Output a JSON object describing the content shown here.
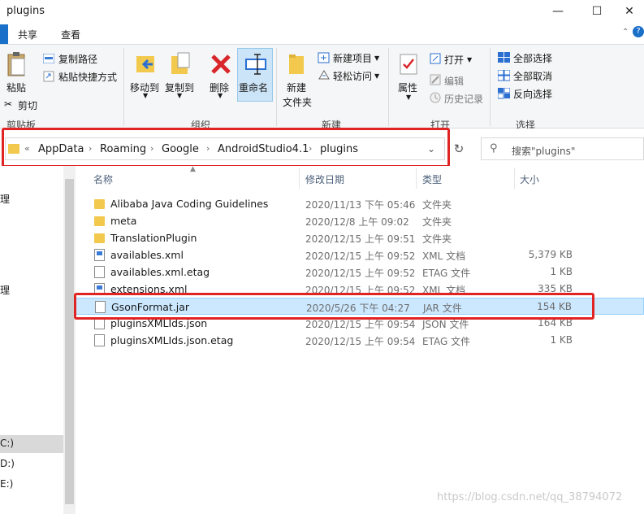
{
  "window": {
    "title": "plugins",
    "min": "—",
    "max": "☐",
    "close": "✕"
  },
  "tabs": {
    "share": "共享",
    "view": "查看",
    "help": "?"
  },
  "ribbon": {
    "clipboard": {
      "label": "剪贴板",
      "paste": "粘贴",
      "cut": "剪切",
      "copy_path": "复制路径",
      "paste_shortcut": "粘贴快捷方式"
    },
    "organize": {
      "label": "组织",
      "move_to": "移动到",
      "copy_to": "复制到",
      "delete": "删除",
      "rename": "重命名"
    },
    "new": {
      "label": "新建",
      "new_folder_1": "新建",
      "new_folder_2": "文件夹",
      "new_item": "新建项目",
      "easy_access": "轻松访问"
    },
    "open": {
      "label": "打开",
      "properties": "属性",
      "open": "打开",
      "edit": "编辑",
      "history": "历史记录"
    },
    "select": {
      "label": "选择",
      "select_all": "全部选择",
      "select_none": "全部取消",
      "invert": "反向选择"
    }
  },
  "address": {
    "overflow": "«",
    "crumbs": [
      "AppData",
      "Roaming",
      "Google",
      "AndroidStudio4.1",
      "plugins"
    ],
    "search_placeholder": "搜索\"plugins\""
  },
  "nav": {
    "items": [
      "理",
      "",
      "C:)",
      "D:)",
      "E:)"
    ]
  },
  "columns": {
    "name": "名称",
    "date": "修改日期",
    "type": "类型",
    "size": "大小"
  },
  "files": [
    {
      "name": "Alibaba Java Coding Guidelines",
      "date": "2020/11/13 下午 05:46",
      "type": "文件夹",
      "size": "",
      "icon": "folder"
    },
    {
      "name": "meta",
      "date": "2020/12/8 上午 09:02",
      "type": "文件夹",
      "size": "",
      "icon": "folder"
    },
    {
      "name": "TranslationPlugin",
      "date": "2020/12/15 上午 09:51",
      "type": "文件夹",
      "size": "",
      "icon": "folder"
    },
    {
      "name": "availables.xml",
      "date": "2020/12/15 上午 09:52",
      "type": "XML 文档",
      "size": "5,379 KB",
      "icon": "xml"
    },
    {
      "name": "availables.xml.etag",
      "date": "2020/12/15 上午 09:52",
      "type": "ETAG 文件",
      "size": "1 KB",
      "icon": "doc"
    },
    {
      "name": "extensions.xml",
      "date": "2020/12/15 上午 09:52",
      "type": "XML 文档",
      "size": "335 KB",
      "icon": "xml"
    },
    {
      "name": "GsonFormat.jar",
      "date": "2020/5/26 下午 04:27",
      "type": "JAR 文件",
      "size": "154 KB",
      "icon": "doc"
    },
    {
      "name": "pluginsXMLIds.json",
      "date": "2020/12/15 上午 09:54",
      "type": "JSON 文件",
      "size": "164 KB",
      "icon": "doc"
    },
    {
      "name": "pluginsXMLIds.json.etag",
      "date": "2020/12/15 上午 09:54",
      "type": "ETAG 文件",
      "size": "1 KB",
      "icon": "doc"
    }
  ],
  "watermark": "https://blog.csdn.net/qq_38794072",
  "colors": {
    "highlight": "#e02424",
    "selection": "#cce8ff",
    "accent": "#1a6fc9"
  }
}
